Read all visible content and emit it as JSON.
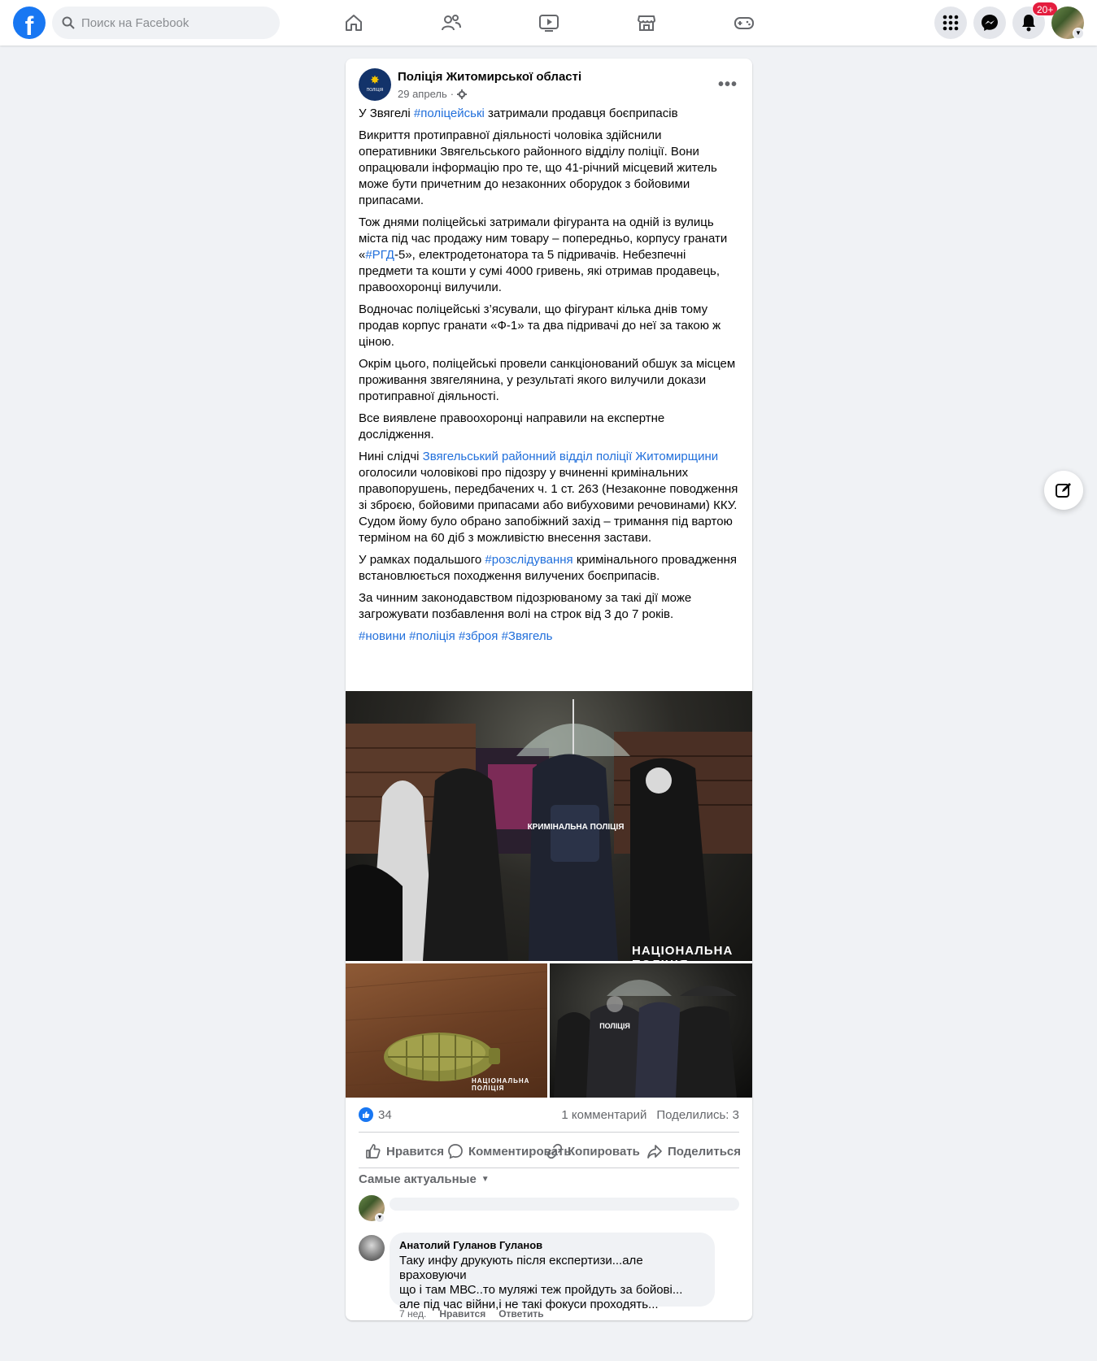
{
  "topbar": {
    "logo": "f",
    "search_placeholder": "Поиск на Facebook",
    "notifications_badge": "20+",
    "nav_icons": [
      "home-icon",
      "friends-icon",
      "watch-icon",
      "marketplace-icon",
      "gaming-icon"
    ],
    "right_icons": [
      "menu-grid-icon",
      "messenger-icon",
      "bell-icon"
    ]
  },
  "post": {
    "page_name": "Поліція Житомирської області",
    "date": "29 апрель",
    "date_separator": "·",
    "avatar_text": "ПОЛІЦІЯ",
    "paragraphs": {
      "p1_before": "У Звягелі ",
      "p1_link": "#поліцейські",
      "p1_after": " затримали продавця боєприпасів",
      "p2": "Викриття протиправної діяльності чоловіка здійснили оперативники Звягельського районного відділу поліції. Вони опрацювали інформацію про те, що 41-річний місцевий житель може бути причетним до незаконних оборудок з бойовими припасами.",
      "p3_before": "Тож днями поліцейські затримали фігуранта на одній із вулиць міста під час продажу ним товару – попередньо, корпусу гранати «",
      "p3_link": "#РГД",
      "p3_after": "-5», електродетонатора та 5 підривачів. Небезпечні предмети та кошти у сумі 4000 гривень, які отримав продавець, правоохоронці вилучили.",
      "p4": "Водночас поліцейські з’ясували, що фігурант кілька днів тому продав корпус гранати «Ф-1» та два підривачі до неї за такою ж ціною.",
      "p5": "Окрім цього, поліцейські провели санкціонований обшук за місцем проживання звягелянина, у результаті якого вилучили докази протиправної діяльності.",
      "p6": "Все виявлене правоохоронці направили на експертне дослідження.",
      "p7_before": "Нині слідчі ",
      "p7_link": "Звягельський районний відділ поліції Житомирщини",
      "p7_after": " оголосили чоловікові про підозру у вчиненні кримінальних правопорушень, передбачених ч. 1 ст. 263 (Незаконне поводження зі зброєю, бойовими припасами або вибуховими речовинами) ККУ. Судом йому було обрано запобіжний захід – тримання під вартою терміном на 60 діб з можливістю внесення застави.",
      "p8_before": "У рамках подальшого ",
      "p8_link": "#розслідування",
      "p8_after": " кримінального провадження встановлюється походження вилучених боєприпасів.",
      "p9": "За чинним законодавством підозрюваному за такі дії може загрожувати позбавлення волі на строк від 3 до 7 років.",
      "tags": [
        "#новини",
        "#поліція",
        "#зброя",
        "#Звягель"
      ]
    },
    "photos": {
      "watermark_1": "НАЦІОНАЛЬНА ПОЛІЦІЯ",
      "watermark_2": "НАЦІОНАЛЬНА ПОЛІЦІЯ",
      "vest_text": "КРИМІНАЛЬНА ПОЛІЦІЯ",
      "jacket_text": "ПОЛІЦІЯ"
    },
    "stats": {
      "likes": "34",
      "comments": "1 комментарий",
      "shares": "Поделились: 3"
    },
    "actions": {
      "like": "Нравится",
      "comment": "Комментировать",
      "copy": "Копировать",
      "share": "Поделиться"
    },
    "sort_label": "Самые актуальные"
  },
  "comment": {
    "author": "Анатолий Гуланов Гуланов",
    "line1": "Таку инфу друкують після експертизи...але враховуючи",
    "line2": "що і там МВС..то муляжі теж пройдуть за бойові...",
    "line3": "але під час війни,і не такі фокуси проходять...",
    "time": "7 нед.",
    "like": "Нравится",
    "reply": "Ответить"
  },
  "colors": {
    "brand": "#1877f2",
    "link": "#216fdb",
    "badge": "#e41e3f",
    "muted": "#65676b",
    "background": "#f0f2f5"
  }
}
